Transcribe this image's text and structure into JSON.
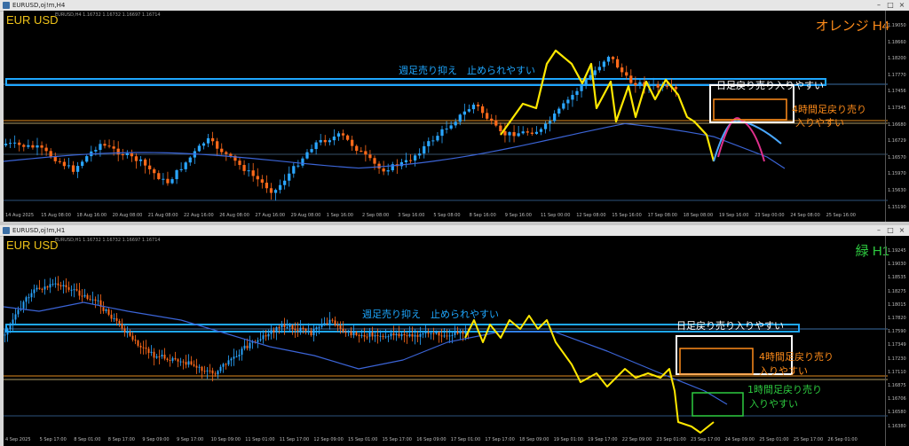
{
  "top": {
    "window_title": "EURUSD,oj!m,H4",
    "symbol": "EUR USD",
    "ohlc_text": "EURUSD,H4 1.16732 1.16732 1.16697 1.16714",
    "timeframe_label": "オレンジ H4",
    "colors": {
      "timeframe": "#ff8c1a",
      "symbol": "#f0c419",
      "weekly_box": "#1ea7ff",
      "projection_up": "#4aa8ff",
      "projection_down": "#e0308c"
    },
    "weekly_text": "週足売り抑え　止められやすい",
    "daily_text": "日足戻り売り入りやすい",
    "h4_text_1": "4時間足戻り売り",
    "h4_text_2": "入りやすい",
    "price_labels": [
      "1.19050",
      "1.18660",
      "1.18200",
      "1.17770",
      "1.17456",
      "1.17345",
      "1.16680",
      "1.16729",
      "1.16570",
      "1.15970",
      "1.15630",
      "1.15190"
    ],
    "time_labels": [
      "14 Aug 2025",
      "15 Aug 08:00",
      "18 Aug 16:00",
      "20 Aug 08:00",
      "21 Aug 08:00",
      "22 Aug 16:00",
      "26 Aug 08:00",
      "27 Aug 16:00",
      "29 Aug 08:00",
      "1 Sep 16:00",
      "2 Sep 08:00",
      "3 Sep 16:00",
      "5 Sep 08:00",
      "8 Sep 16:00",
      "9 Sep 16:00",
      "11 Sep 00:00",
      "12 Sep 08:00",
      "15 Sep 16:00",
      "17 Sep 08:00",
      "18 Sep 08:00",
      "19 Sep 16:00",
      "23 Sep 00:00",
      "24 Sep 08:00",
      "25 Sep 16:00"
    ]
  },
  "bottom": {
    "window_title": "EURUSD,oj!m,H1",
    "symbol": "EUR USD",
    "ohlc_text": "EURUSD,H1 1.16732 1.16732 1.16697 1.16714",
    "timeframe_label": "緑 H1",
    "colors": {
      "timeframe": "#2ecc40",
      "h1_box": "#2ecc40"
    },
    "weekly_text": "週足売り抑え　止められやすい",
    "daily_text": "日足戻り売り入りやすい",
    "h4_text_1": "4時間足戻り売り",
    "h4_text_2": "入りやすい",
    "h1_text_1": "1時間足戻り売り",
    "h1_text_2": "入りやすい",
    "price_labels": [
      "1.19245",
      "1.19030",
      "1.18535",
      "1.18275",
      "1.18015",
      "1.17820",
      "1.17590",
      "1.17349",
      "1.17230",
      "1.17110",
      "1.16875",
      "1.16706",
      "1.16580",
      "1.16380"
    ],
    "time_labels": [
      "4 Sep 2025",
      "5 Sep 17:00",
      "8 Sep 01:00",
      "8 Sep 17:00",
      "9 Sep 09:00",
      "9 Sep 17:00",
      "10 Sep 09:00",
      "11 Sep 01:00",
      "11 Sep 17:00",
      "12 Sep 09:00",
      "15 Sep 01:00",
      "15 Sep 17:00",
      "16 Sep 09:00",
      "17 Sep 01:00",
      "17 Sep 17:00",
      "18 Sep 09:00",
      "19 Sep 01:00",
      "19 Sep 17:00",
      "22 Sep 09:00",
      "23 Sep 01:00",
      "23 Sep 17:00",
      "24 Sep 09:00",
      "25 Sep 01:00",
      "25 Sep 17:00",
      "26 Sep 01:00"
    ]
  }
}
